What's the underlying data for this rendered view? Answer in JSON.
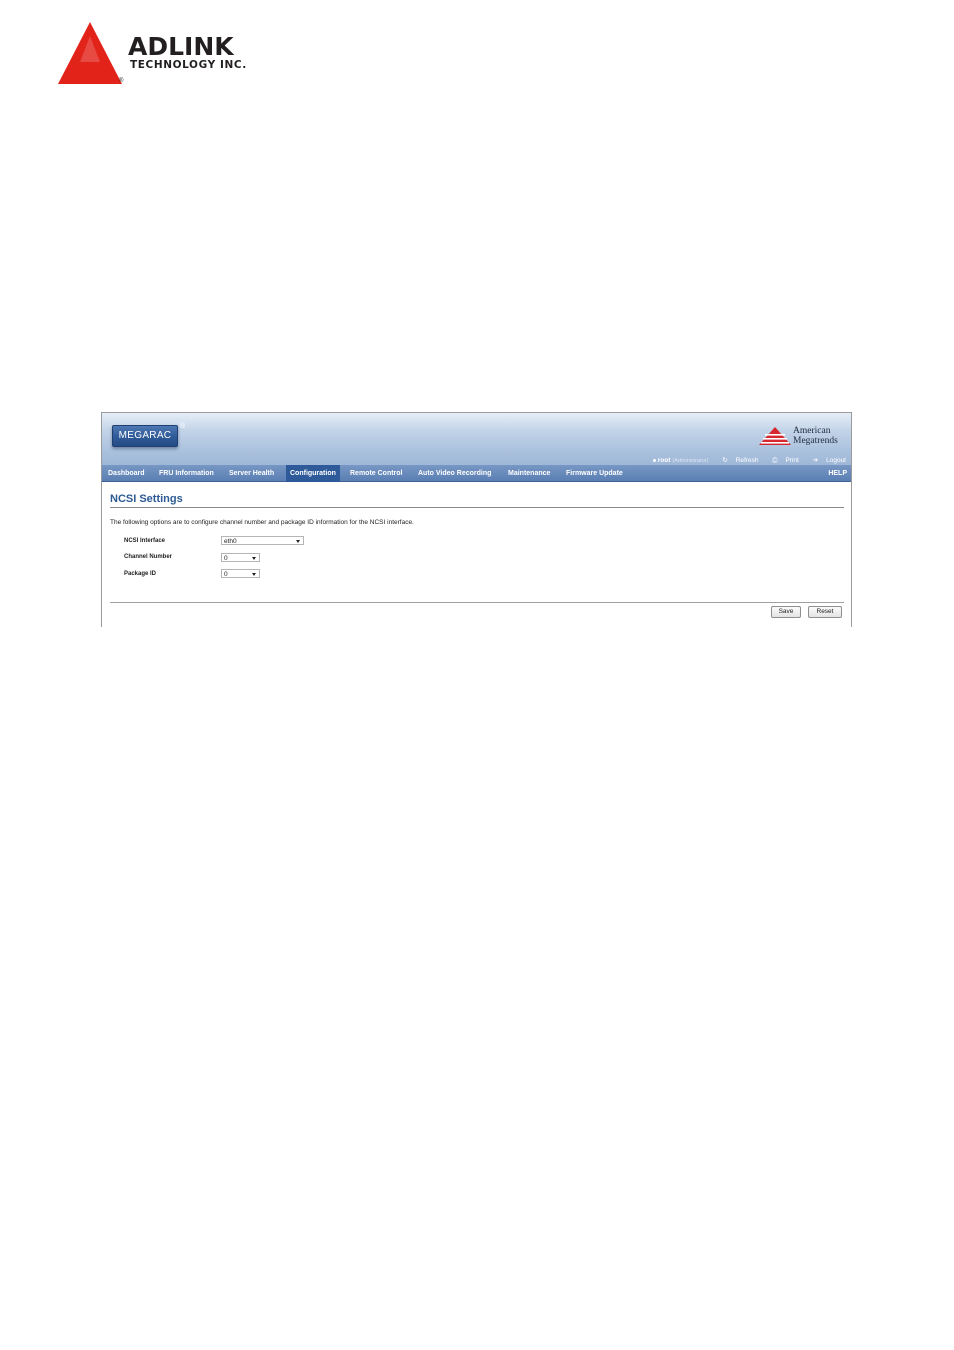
{
  "document_header": {
    "brand_name": "ADLINK",
    "brand_sub": "TECHNOLOGY INC.",
    "brand_reg": "®",
    "brand_color": "#e2231a"
  },
  "app": {
    "product_name": "MEGARAC",
    "product_reg": "®",
    "vendor_line1": "American",
    "vendor_line2": "Megatrends"
  },
  "user_bar": {
    "user": "root",
    "role": "(Administrator)",
    "refresh_label": "Refresh",
    "print_label": "Print",
    "logout_label": "Logout"
  },
  "nav": {
    "items": [
      {
        "label": "Dashboard"
      },
      {
        "label": "FRU Information"
      },
      {
        "label": "Server Health"
      },
      {
        "label": "Configuration"
      },
      {
        "label": "Remote Control"
      },
      {
        "label": "Auto Video Recording"
      },
      {
        "label": "Maintenance"
      },
      {
        "label": "Firmware Update"
      }
    ],
    "active": "Configuration",
    "help_label": "HELP"
  },
  "page": {
    "title": "NCSI Settings",
    "description": "The following options are to configure channel number and package ID information for the NCSI interface.",
    "fields": [
      {
        "label": "NCSI Interface",
        "value": "eth0"
      },
      {
        "label": "Channel Number",
        "value": "0"
      },
      {
        "label": "Package ID",
        "value": "0"
      }
    ],
    "save_label": "Save",
    "reset_label": "Reset"
  },
  "colors": {
    "nav_bg": "#5b7fb4",
    "nav_active": "#2e5a9a",
    "title_color": "#2c5a93"
  }
}
